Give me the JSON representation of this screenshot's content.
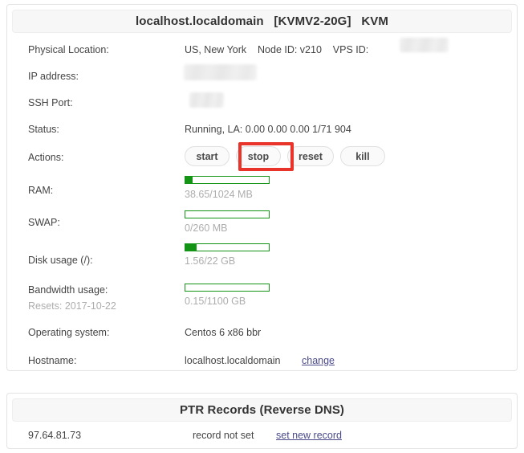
{
  "vps_panel": {
    "header": "localhost.localdomain   [KVMV2-20G]   KVM",
    "rows": {
      "physical_location": {
        "label": "Physical Location:",
        "value": "US, New York    Node ID: v210    VPS ID:",
        "vps_id_redacted": true
      },
      "ip_address": {
        "label": "IP address:",
        "value_redacted": true
      },
      "ssh_port": {
        "label": "SSH Port:",
        "value_redacted": true
      },
      "status": {
        "label": "Status:",
        "value": "Running, LA: 0.00 0.00 0.00 1/71 904"
      },
      "actions": {
        "label": "Actions:",
        "buttons": [
          {
            "label": "start",
            "name": "start-button"
          },
          {
            "label": "stop",
            "name": "stop-button",
            "highlighted": true
          },
          {
            "label": "reset",
            "name": "reset-button"
          },
          {
            "label": "kill",
            "name": "kill-button"
          }
        ]
      },
      "ram": {
        "label": "RAM:",
        "value": "38.65/1024 MB",
        "used": 38.65,
        "total": 1024,
        "fill_percent": 9
      },
      "swap": {
        "label": "SWAP:",
        "value": "0/260 MB",
        "used": 0,
        "total": 260,
        "fill_percent": 0
      },
      "disk_usage": {
        "label": "Disk usage (/):",
        "value": "1.56/22 GB",
        "used": 1.56,
        "total": 22,
        "fill_percent": 13
      },
      "bandwidth_usage": {
        "label": "Bandwidth usage:",
        "sublabel": "Resets: 2017-10-22",
        "value": "0.15/1100 GB",
        "used": 0.15,
        "total": 1100,
        "fill_percent": 0
      },
      "operating_system": {
        "label": "Operating system:",
        "value": "Centos 6 x86 bbr"
      },
      "hostname": {
        "label": "Hostname:",
        "value": "localhost.localdomain",
        "change_link": "change"
      }
    }
  },
  "ptr_panel": {
    "header": "PTR Records (Reverse DNS)",
    "record": {
      "ip": "97.64.81.73",
      "status": "record not set",
      "action_link": "set new record"
    }
  },
  "colors": {
    "accent_green": "#149414",
    "highlight_red": "#e8342a",
    "link": "#4a4a8a",
    "muted_text": "#adadad"
  }
}
